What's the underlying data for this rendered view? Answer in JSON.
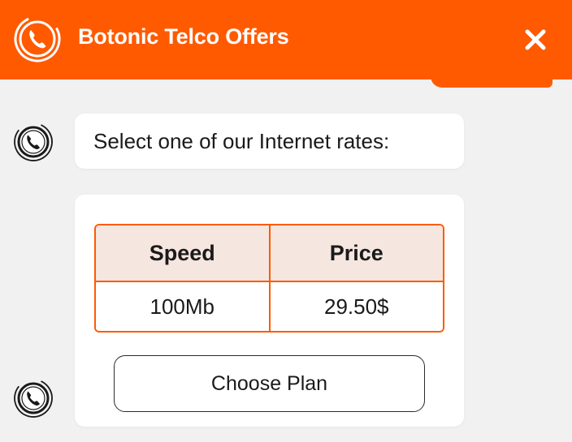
{
  "header": {
    "title": "Botonic Telco Offers",
    "close_label": "×",
    "background_color": "#ff5a00"
  },
  "messages": [
    {
      "sender": "bot",
      "text": "Select one of our Internet rates:"
    }
  ],
  "rates_card": {
    "columns": [
      "Speed",
      "Price"
    ],
    "rows": [
      [
        "100Mb",
        "29.50$"
      ]
    ],
    "button_label": "Choose Plan"
  },
  "icons": {
    "header_logo": "phone-icon",
    "bot_avatar": "phone-icon",
    "close": "close-icon"
  },
  "colors": {
    "accent": "#ff5a00",
    "table_header_bg": "#f6e6e0",
    "page_bg": "#f1f1f1"
  }
}
